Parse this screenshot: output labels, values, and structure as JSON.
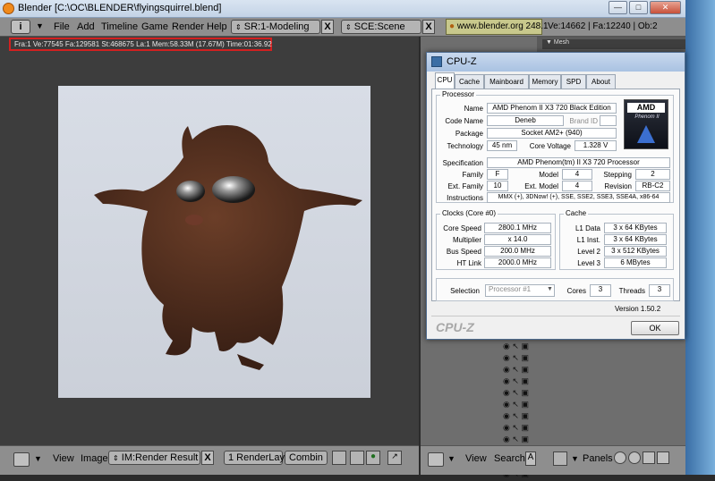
{
  "blender": {
    "window_title": "Blender [C:\\OC\\BLENDER\\flyingsquirrel.blend]",
    "menu": [
      "File",
      "Add",
      "Timeline",
      "Game",
      "Render",
      "Help"
    ],
    "screen": "SR:1-Modeling",
    "scene": "SCE:Scene",
    "url_version": "www.blender.org 248.1",
    "stats_right": "Ve:14662 | Fa:12240 | Ob:2",
    "render_stats": "Fra:1  Ve:77545 Fa:129581 St:468675 La:1 Mem:58.33M (17.67M) Time:01:36.92",
    "panel_tabs": [
      "Mesh"
    ],
    "bottom_left": {
      "view": "View",
      "image": "Image",
      "im_field": "IM:Render Result",
      "render_layer": "1 RenderLay",
      "pass": "Combin"
    },
    "bottom_right": {
      "view": "View",
      "search": "Search",
      "a_label": "A",
      "panels": "Panels"
    },
    "outliner_rows": 12
  },
  "cpuz": {
    "title": "CPU-Z",
    "tabs": [
      "CPU",
      "Cache",
      "Mainboard",
      "Memory",
      "SPD",
      "About"
    ],
    "active_tab": "CPU",
    "processor": {
      "group": "Processor",
      "name_label": "Name",
      "name": "AMD Phenom II X3 720 Black Edition",
      "codename_label": "Code Name",
      "codename": "Deneb",
      "brandid_label": "Brand ID",
      "brandid": "",
      "package_label": "Package",
      "package": "Socket AM2+ (940)",
      "technology_label": "Technology",
      "technology": "45 nm",
      "voltage_label": "Core Voltage",
      "voltage": "1.328 V",
      "spec_label": "Specification",
      "spec": "AMD Phenom(tm) II X3 720 Processor",
      "family_label": "Family",
      "family": "F",
      "model_label": "Model",
      "model": "4",
      "stepping_label": "Stepping",
      "stepping": "2",
      "extfamily_label": "Ext. Family",
      "extfamily": "10",
      "extmodel_label": "Ext. Model",
      "extmodel": "4",
      "revision_label": "Revision",
      "revision": "RB-C2",
      "instructions_label": "Instructions",
      "instructions": "MMX (+), 3DNow! (+), SSE, SSE2, SSE3, SSE4A, x86-64",
      "logo_top": "AMD",
      "logo_sub": "Phenom II"
    },
    "clocks": {
      "group": "Clocks (Core #0)",
      "core_speed_label": "Core Speed",
      "core_speed": "2800.1 MHz",
      "multiplier_label": "Multiplier",
      "multiplier": "x 14.0",
      "bus_speed_label": "Bus Speed",
      "bus_speed": "200.0 MHz",
      "ht_link_label": "HT Link",
      "ht_link": "2000.0 MHz"
    },
    "cache": {
      "group": "Cache",
      "l1d_label": "L1 Data",
      "l1d": "3 x 64 KBytes",
      "l1i_label": "L1 Inst.",
      "l1i": "3 x 64 KBytes",
      "l2_label": "Level 2",
      "l2": "3 x 512 KBytes",
      "l3_label": "Level 3",
      "l3": "6 MBytes"
    },
    "selection": {
      "label": "Selection",
      "value": "Processor #1",
      "cores_label": "Cores",
      "cores": "3",
      "threads_label": "Threads",
      "threads": "3"
    },
    "version": "Version 1.50.2",
    "footer_logo": "CPU-Z",
    "ok": "OK"
  },
  "colors": {
    "creature": "#4a2a1c",
    "canvas": "#d3d8e1",
    "highlight": "#d32020",
    "blender_header": "#8e8e8e"
  }
}
